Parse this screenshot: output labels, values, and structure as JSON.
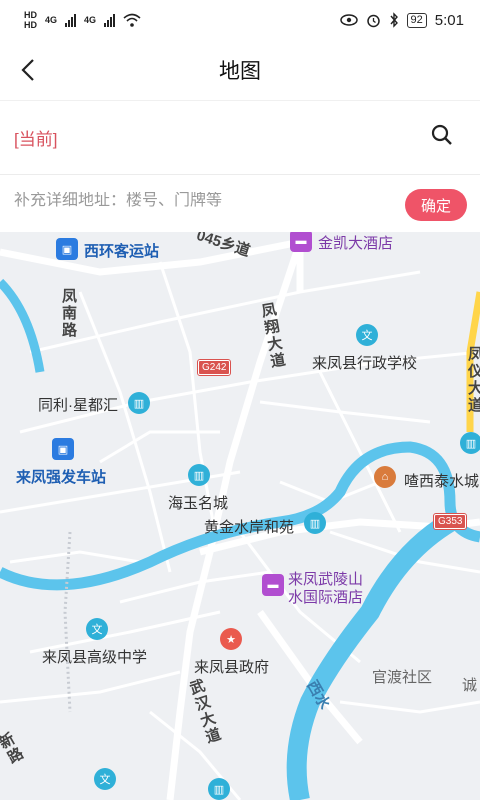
{
  "status": {
    "time": "5:01",
    "battery": "92",
    "hd1": "HD",
    "hd2": "HD",
    "net1": "4G",
    "net2": "4G"
  },
  "nav": {
    "title": "地图",
    "back_icon": "chevron-left-icon"
  },
  "search": {
    "current_label": "[当前]",
    "icon": "search-icon"
  },
  "address": {
    "placeholder": "补充详细地址：楼号、门牌等",
    "value": "",
    "confirm_label": "确定"
  },
  "colors": {
    "accent": "#ef5468",
    "current_text": "#d8525e",
    "river": "#5cc4ec",
    "map_bg": "#eef0f3"
  },
  "map": {
    "pois": [
      {
        "name": "西环客运站",
        "icon": "bus-icon"
      },
      {
        "name": "金凯大酒店",
        "icon": "hotel-icon"
      },
      {
        "name": "来凤县行政学校",
        "icon": "school-icon"
      },
      {
        "name": "同利·星都汇",
        "icon": "building-icon"
      },
      {
        "name": "来凤强发车站",
        "icon": "bus-icon"
      },
      {
        "name": "喳西泰水城",
        "icon": "attraction-icon"
      },
      {
        "name": "海玉名城",
        "icon": "building-icon"
      },
      {
        "name": "黄金水岸和苑",
        "icon": "building-icon"
      },
      {
        "name": "来凤武陵山",
        "icon": "hotel-icon"
      },
      {
        "name": "水国际酒店",
        "icon": "hotel-icon"
      },
      {
        "name": "来凤县高级中学",
        "icon": "school-icon"
      },
      {
        "name": "来凤县政府",
        "icon": "government-icon"
      },
      {
        "name": "官渡社区",
        "icon": ""
      },
      {
        "name": "诚",
        "icon": ""
      }
    ],
    "roads": [
      "045乡道",
      "凤南路",
      "凤翔大道",
      "武汉大道",
      "凤仪大道",
      "西水",
      "新路"
    ],
    "shields": [
      "G242",
      "G353"
    ]
  }
}
